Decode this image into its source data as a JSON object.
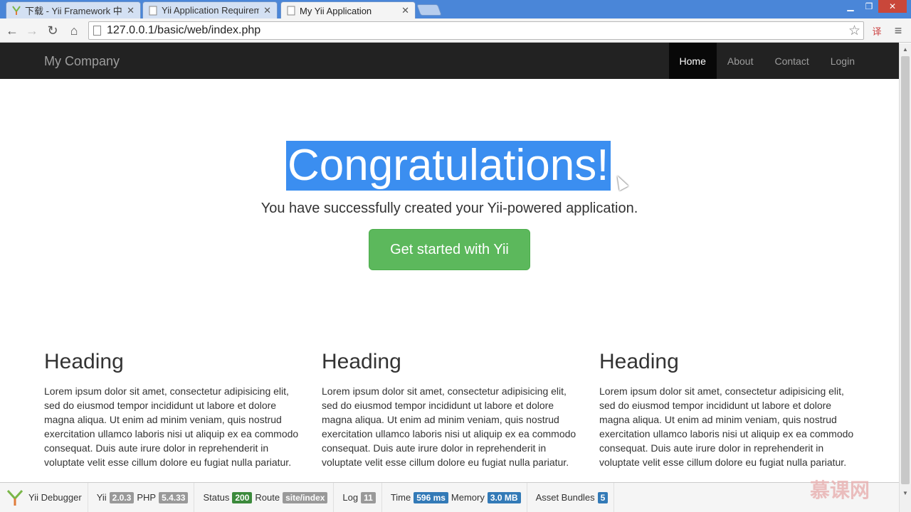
{
  "browser": {
    "tabs": [
      {
        "title": "下载 - Yii Framework 中文",
        "active": false
      },
      {
        "title": "Yii Application Requirements",
        "active": false
      },
      {
        "title": "My Yii Application",
        "active": true
      }
    ],
    "address": "127.0.0.1/basic/web/index.php"
  },
  "navbar": {
    "brand": "My Company",
    "items": [
      {
        "label": "Home",
        "active": true
      },
      {
        "label": "About",
        "active": false
      },
      {
        "label": "Contact",
        "active": false
      },
      {
        "label": "Login",
        "active": false
      }
    ]
  },
  "jumbotron": {
    "title": "Congratulations!",
    "lead": "You have successfully created your Yii-powered application.",
    "button": "Get started with Yii"
  },
  "columns": [
    {
      "heading": "Heading",
      "body": "Lorem ipsum dolor sit amet, consectetur adipisicing elit, sed do eiusmod tempor incididunt ut labore et dolore magna aliqua. Ut enim ad minim veniam, quis nostrud exercitation ullamco laboris nisi ut aliquip ex ea commodo consequat. Duis aute irure dolor in reprehenderit in voluptate velit esse cillum dolore eu fugiat nulla pariatur."
    },
    {
      "heading": "Heading",
      "body": "Lorem ipsum dolor sit amet, consectetur adipisicing elit, sed do eiusmod tempor incididunt ut labore et dolore magna aliqua. Ut enim ad minim veniam, quis nostrud exercitation ullamco laboris nisi ut aliquip ex ea commodo consequat. Duis aute irure dolor in reprehenderit in voluptate velit esse cillum dolore eu fugiat nulla pariatur."
    },
    {
      "heading": "Heading",
      "body": "Lorem ipsum dolor sit amet, consectetur adipisicing elit, sed do eiusmod tempor incididunt ut labore et dolore magna aliqua. Ut enim ad minim veniam, quis nostrud exercitation ullamco laboris nisi ut aliquip ex ea commodo consequat. Duis aute irure dolor in reprehenderit in voluptate velit esse cillum dolore eu fugiat nulla pariatur."
    }
  ],
  "debugbar": {
    "title": "Yii Debugger",
    "yii_label": "Yii",
    "yii_version": "2.0.3",
    "php_label": "PHP",
    "php_version": "5.4.33",
    "status_label": "Status",
    "status": "200",
    "route_label": "Route",
    "route": "site/index",
    "log_label": "Log",
    "log": "11",
    "time_label": "Time",
    "time": "596 ms",
    "memory_label": "Memory",
    "memory": "3.0 MB",
    "assets_label": "Asset Bundles",
    "assets": "5"
  },
  "watermark": "慕课网",
  "colors": {
    "navbar_bg": "#222222",
    "selection": "#3b8ef0",
    "success": "#5cb85c"
  }
}
